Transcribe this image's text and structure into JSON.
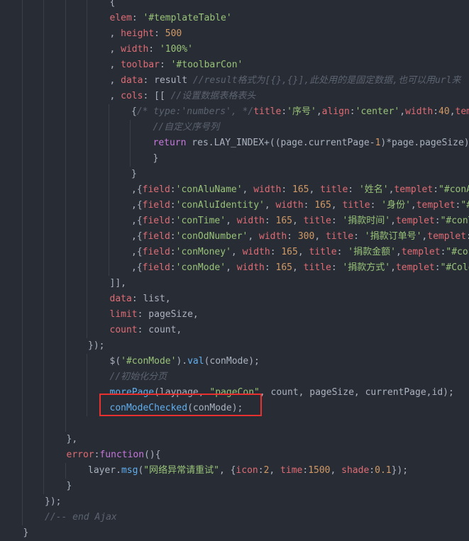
{
  "lines": [
    {
      "indent": 5,
      "tokens": [
        {
          "c": "t-pun",
          "t": "{"
        }
      ]
    },
    {
      "indent": 5,
      "tokens": [
        {
          "c": "t-key",
          "t": "elem"
        },
        {
          "c": "t-pun",
          "t": ": "
        },
        {
          "c": "t-str",
          "t": "'#templateTable'"
        }
      ]
    },
    {
      "indent": 5,
      "tokens": [
        {
          "c": "t-pun",
          "t": ", "
        },
        {
          "c": "t-key",
          "t": "height"
        },
        {
          "c": "t-pun",
          "t": ": "
        },
        {
          "c": "t-num",
          "t": "500"
        }
      ]
    },
    {
      "indent": 5,
      "tokens": [
        {
          "c": "t-pun",
          "t": ", "
        },
        {
          "c": "t-key",
          "t": "width"
        },
        {
          "c": "t-pun",
          "t": ": "
        },
        {
          "c": "t-str",
          "t": "'100%'"
        }
      ]
    },
    {
      "indent": 5,
      "tokens": [
        {
          "c": "t-pun",
          "t": ", "
        },
        {
          "c": "t-key",
          "t": "toolbar"
        },
        {
          "c": "t-pun",
          "t": ": "
        },
        {
          "c": "t-str",
          "t": "'#toolbarCon'"
        }
      ]
    },
    {
      "indent": 5,
      "tokens": [
        {
          "c": "t-pun",
          "t": ", "
        },
        {
          "c": "t-key",
          "t": "data"
        },
        {
          "c": "t-pun",
          "t": ": "
        },
        {
          "c": "t-plain",
          "t": "result "
        },
        {
          "c": "t-cmt",
          "t": "//result格式为[{},{}],此处用的是固定数据,也可以用url来"
        }
      ]
    },
    {
      "indent": 5,
      "tokens": [
        {
          "c": "t-pun",
          "t": ", "
        },
        {
          "c": "t-key",
          "t": "cols"
        },
        {
          "c": "t-pun",
          "t": ": [[ "
        },
        {
          "c": "t-cmt",
          "t": "//设置数据表格表头"
        }
      ]
    },
    {
      "indent": 6,
      "tokens": [
        {
          "c": "t-pun",
          "t": "{"
        },
        {
          "c": "t-cmt",
          "t": "/* type:'numbers', */"
        },
        {
          "c": "t-key",
          "t": "title"
        },
        {
          "c": "t-pun",
          "t": ":"
        },
        {
          "c": "t-str",
          "t": "'序号'"
        },
        {
          "c": "t-pun",
          "t": ","
        },
        {
          "c": "t-key",
          "t": "align"
        },
        {
          "c": "t-pun",
          "t": ":"
        },
        {
          "c": "t-str",
          "t": "'center'"
        },
        {
          "c": "t-pun",
          "t": ","
        },
        {
          "c": "t-key",
          "t": "width"
        },
        {
          "c": "t-pun",
          "t": ":"
        },
        {
          "c": "t-num",
          "t": "40"
        },
        {
          "c": "t-pun",
          "t": ","
        },
        {
          "c": "t-key",
          "t": "temp"
        }
      ]
    },
    {
      "indent": 7,
      "tokens": [
        {
          "c": "t-cmt",
          "t": "//自定义序号列"
        }
      ]
    },
    {
      "indent": 7,
      "tokens": [
        {
          "c": "t-kw",
          "t": "return "
        },
        {
          "c": "t-plain",
          "t": "res.LAY_INDEX+((page.currentPage-"
        },
        {
          "c": "t-num",
          "t": "1"
        },
        {
          "c": "t-plain",
          "t": ")*page.pageSize);"
        }
      ]
    },
    {
      "indent": 7,
      "tokens": [
        {
          "c": "t-pun",
          "t": "}"
        }
      ]
    },
    {
      "indent": 6,
      "tokens": [
        {
          "c": "t-pun",
          "t": "}"
        }
      ]
    },
    {
      "indent": 6,
      "tokens": [
        {
          "c": "t-pun",
          "t": ",{"
        },
        {
          "c": "t-key",
          "t": "field"
        },
        {
          "c": "t-pun",
          "t": ":"
        },
        {
          "c": "t-str",
          "t": "'conAluName'"
        },
        {
          "c": "t-pun",
          "t": ", "
        },
        {
          "c": "t-key",
          "t": "width"
        },
        {
          "c": "t-pun",
          "t": ": "
        },
        {
          "c": "t-num",
          "t": "165"
        },
        {
          "c": "t-pun",
          "t": ", "
        },
        {
          "c": "t-key",
          "t": "title"
        },
        {
          "c": "t-pun",
          "t": ": "
        },
        {
          "c": "t-str",
          "t": "'姓名'"
        },
        {
          "c": "t-pun",
          "t": ","
        },
        {
          "c": "t-key",
          "t": "templet"
        },
        {
          "c": "t-pun",
          "t": ":"
        },
        {
          "c": "t-str",
          "t": "\"#conAl"
        }
      ]
    },
    {
      "indent": 6,
      "tokens": [
        {
          "c": "t-pun",
          "t": ",{"
        },
        {
          "c": "t-key",
          "t": "field"
        },
        {
          "c": "t-pun",
          "t": ":"
        },
        {
          "c": "t-str",
          "t": "'conAluIdentity'"
        },
        {
          "c": "t-pun",
          "t": ", "
        },
        {
          "c": "t-key",
          "t": "width"
        },
        {
          "c": "t-pun",
          "t": ": "
        },
        {
          "c": "t-num",
          "t": "165"
        },
        {
          "c": "t-pun",
          "t": ", "
        },
        {
          "c": "t-key",
          "t": "title"
        },
        {
          "c": "t-pun",
          "t": ": "
        },
        {
          "c": "t-str",
          "t": "'身份'"
        },
        {
          "c": "t-pun",
          "t": ","
        },
        {
          "c": "t-key",
          "t": "templet"
        },
        {
          "c": "t-pun",
          "t": ":"
        },
        {
          "c": "t-str",
          "t": "\"#"
        }
      ]
    },
    {
      "indent": 6,
      "tokens": [
        {
          "c": "t-pun",
          "t": ",{"
        },
        {
          "c": "t-key",
          "t": "field"
        },
        {
          "c": "t-pun",
          "t": ":"
        },
        {
          "c": "t-str",
          "t": "'conTime'"
        },
        {
          "c": "t-pun",
          "t": ", "
        },
        {
          "c": "t-key",
          "t": "width"
        },
        {
          "c": "t-pun",
          "t": ": "
        },
        {
          "c": "t-num",
          "t": "165"
        },
        {
          "c": "t-pun",
          "t": ", "
        },
        {
          "c": "t-key",
          "t": "title"
        },
        {
          "c": "t-pun",
          "t": ": "
        },
        {
          "c": "t-str",
          "t": "'捐款时间'"
        },
        {
          "c": "t-pun",
          "t": ","
        },
        {
          "c": "t-key",
          "t": "templet"
        },
        {
          "c": "t-pun",
          "t": ":"
        },
        {
          "c": "t-str",
          "t": "\"#conT"
        }
      ]
    },
    {
      "indent": 6,
      "tokens": [
        {
          "c": "t-pun",
          "t": ",{"
        },
        {
          "c": "t-key",
          "t": "field"
        },
        {
          "c": "t-pun",
          "t": ":"
        },
        {
          "c": "t-str",
          "t": "'conOdNumber'"
        },
        {
          "c": "t-pun",
          "t": ", "
        },
        {
          "c": "t-key",
          "t": "width"
        },
        {
          "c": "t-pun",
          "t": ": "
        },
        {
          "c": "t-num",
          "t": "300"
        },
        {
          "c": "t-pun",
          "t": ", "
        },
        {
          "c": "t-key",
          "t": "title"
        },
        {
          "c": "t-pun",
          "t": ": "
        },
        {
          "c": "t-str",
          "t": "'捐款订单号'"
        },
        {
          "c": "t-pun",
          "t": ","
        },
        {
          "c": "t-key",
          "t": "templet"
        },
        {
          "c": "t-pun",
          "t": ":"
        }
      ]
    },
    {
      "indent": 6,
      "tokens": [
        {
          "c": "t-pun",
          "t": ",{"
        },
        {
          "c": "t-key",
          "t": "field"
        },
        {
          "c": "t-pun",
          "t": ":"
        },
        {
          "c": "t-str",
          "t": "'conMoney'"
        },
        {
          "c": "t-pun",
          "t": ", "
        },
        {
          "c": "t-key",
          "t": "width"
        },
        {
          "c": "t-pun",
          "t": ": "
        },
        {
          "c": "t-num",
          "t": "165"
        },
        {
          "c": "t-pun",
          "t": ", "
        },
        {
          "c": "t-key",
          "t": "title"
        },
        {
          "c": "t-pun",
          "t": ": "
        },
        {
          "c": "t-str",
          "t": "'捐款金额'"
        },
        {
          "c": "t-pun",
          "t": ","
        },
        {
          "c": "t-key",
          "t": "templet"
        },
        {
          "c": "t-pun",
          "t": ":"
        },
        {
          "c": "t-str",
          "t": "\"#con"
        }
      ]
    },
    {
      "indent": 6,
      "tokens": [
        {
          "c": "t-pun",
          "t": ",{"
        },
        {
          "c": "t-key",
          "t": "field"
        },
        {
          "c": "t-pun",
          "t": ":"
        },
        {
          "c": "t-str",
          "t": "'conMode'"
        },
        {
          "c": "t-pun",
          "t": ", "
        },
        {
          "c": "t-key",
          "t": "width"
        },
        {
          "c": "t-pun",
          "t": ": "
        },
        {
          "c": "t-num",
          "t": "165"
        },
        {
          "c": "t-pun",
          "t": ", "
        },
        {
          "c": "t-key",
          "t": "title"
        },
        {
          "c": "t-pun",
          "t": ": "
        },
        {
          "c": "t-str",
          "t": "'捐款方式'"
        },
        {
          "c": "t-pun",
          "t": ","
        },
        {
          "c": "t-key",
          "t": "templet"
        },
        {
          "c": "t-pun",
          "t": ":"
        },
        {
          "c": "t-str",
          "t": "\"#Colo"
        }
      ]
    },
    {
      "indent": 5,
      "tokens": [
        {
          "c": "t-pun",
          "t": "]],"
        }
      ]
    },
    {
      "indent": 5,
      "tokens": [
        {
          "c": "t-key",
          "t": "data"
        },
        {
          "c": "t-pun",
          "t": ": "
        },
        {
          "c": "t-plain",
          "t": "list,"
        }
      ]
    },
    {
      "indent": 5,
      "tokens": [
        {
          "c": "t-key",
          "t": "limit"
        },
        {
          "c": "t-pun",
          "t": ": "
        },
        {
          "c": "t-plain",
          "t": "pageSize,"
        }
      ]
    },
    {
      "indent": 5,
      "tokens": [
        {
          "c": "t-key",
          "t": "count"
        },
        {
          "c": "t-pun",
          "t": ": "
        },
        {
          "c": "t-plain",
          "t": "count,"
        }
      ]
    },
    {
      "indent": 4,
      "tokens": [
        {
          "c": "t-pun",
          "t": "});"
        }
      ]
    },
    {
      "indent": 5,
      "tokens": [
        {
          "c": "t-plain",
          "t": "$("
        },
        {
          "c": "t-str",
          "t": "'#conMode'"
        },
        {
          "c": "t-plain",
          "t": ")."
        },
        {
          "c": "t-fn",
          "t": "val"
        },
        {
          "c": "t-plain",
          "t": "(conMode);"
        }
      ]
    },
    {
      "indent": 5,
      "tokens": [
        {
          "c": "t-cmt",
          "t": "//初始化分页"
        }
      ]
    },
    {
      "indent": 5,
      "tokens": [
        {
          "c": "t-fn",
          "t": "morePage"
        },
        {
          "c": "t-plain",
          "t": "(laypage, "
        },
        {
          "c": "t-str",
          "t": "\"pageCon\""
        },
        {
          "c": "t-plain",
          "t": ", count, pageSize, currentPage,id);"
        }
      ]
    },
    {
      "indent": 5,
      "tokens": [
        {
          "c": "t-fn",
          "t": "conModeChecked"
        },
        {
          "c": "t-plain",
          "t": "(conMode);"
        }
      ]
    },
    {
      "indent": 4,
      "tokens": []
    },
    {
      "indent": 3,
      "tokens": [
        {
          "c": "t-pun",
          "t": "},"
        }
      ]
    },
    {
      "indent": 3,
      "tokens": [
        {
          "c": "t-key",
          "t": "error"
        },
        {
          "c": "t-pun",
          "t": ":"
        },
        {
          "c": "t-kw",
          "t": "function"
        },
        {
          "c": "t-pun",
          "t": "(){"
        }
      ]
    },
    {
      "indent": 4,
      "tokens": [
        {
          "c": "t-plain",
          "t": "layer."
        },
        {
          "c": "t-fn",
          "t": "msg"
        },
        {
          "c": "t-plain",
          "t": "("
        },
        {
          "c": "t-str",
          "t": "\"网络异常请重试\""
        },
        {
          "c": "t-plain",
          "t": ", {"
        },
        {
          "c": "t-key",
          "t": "icon"
        },
        {
          "c": "t-pun",
          "t": ":"
        },
        {
          "c": "t-num",
          "t": "2"
        },
        {
          "c": "t-pun",
          "t": ", "
        },
        {
          "c": "t-key",
          "t": "time"
        },
        {
          "c": "t-pun",
          "t": ":"
        },
        {
          "c": "t-num",
          "t": "1500"
        },
        {
          "c": "t-pun",
          "t": ", "
        },
        {
          "c": "t-key",
          "t": "shade"
        },
        {
          "c": "t-pun",
          "t": ":"
        },
        {
          "c": "t-num",
          "t": "0.1"
        },
        {
          "c": "t-plain",
          "t": "});"
        }
      ]
    },
    {
      "indent": 3,
      "tokens": [
        {
          "c": "t-pun",
          "t": "}"
        }
      ]
    },
    {
      "indent": 2,
      "tokens": [
        {
          "c": "t-pun",
          "t": "});"
        }
      ]
    },
    {
      "indent": 2,
      "tokens": [
        {
          "c": "t-cmt",
          "t": "//-- end Ajax"
        }
      ]
    },
    {
      "indent": 1,
      "tokens": [
        {
          "c": "t-pun",
          "t": "}"
        }
      ]
    }
  ],
  "highlight": {
    "line_index": 26,
    "color": "#e8302e"
  }
}
